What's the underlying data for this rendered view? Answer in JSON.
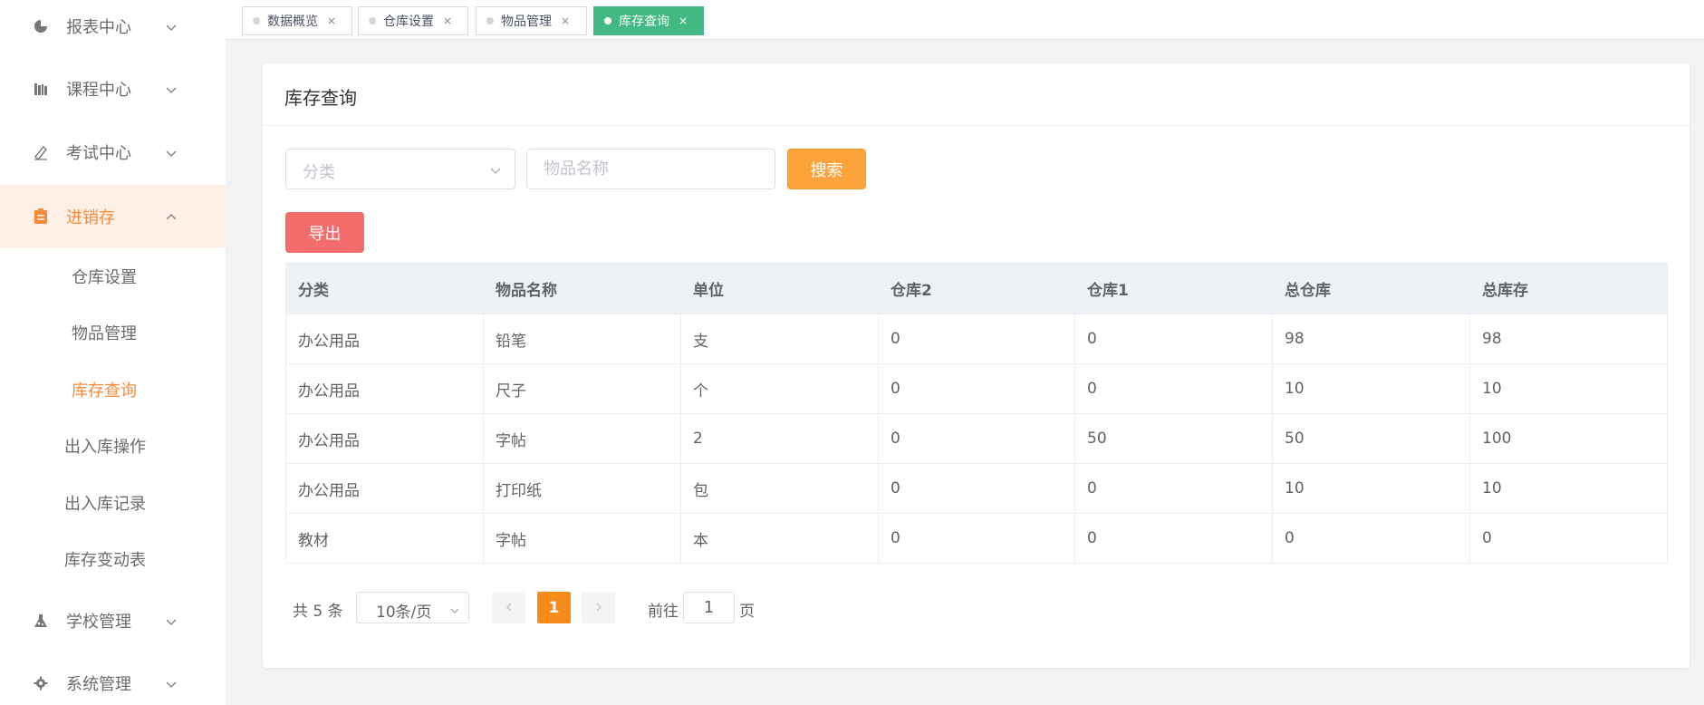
{
  "sidebar": {
    "menus": [
      {
        "label": "报表中心",
        "icon": "pie-chart-icon"
      },
      {
        "label": "课程中心",
        "icon": "books-icon"
      },
      {
        "label": "考试中心",
        "icon": "pen-icon"
      },
      {
        "label": "进销存",
        "icon": "clipboard-icon",
        "active": true
      },
      {
        "label": "学校管理",
        "icon": "flask-icon"
      },
      {
        "label": "系统管理",
        "icon": "gear-icon"
      }
    ],
    "sub_items": [
      {
        "label": "仓库设置"
      },
      {
        "label": "物品管理"
      },
      {
        "label": "库存查询",
        "active": true
      },
      {
        "label": "出入库操作"
      },
      {
        "label": "出入库记录"
      },
      {
        "label": "库存变动表"
      }
    ]
  },
  "tabs": [
    {
      "label": "数据概览",
      "close": "×"
    },
    {
      "label": "仓库设置",
      "close": "×"
    },
    {
      "label": "物品管理",
      "close": "×"
    },
    {
      "label": "库存查询",
      "close": "×",
      "active": true
    }
  ],
  "card": {
    "title": "库存查询",
    "category_placeholder": "分类",
    "name_placeholder": "物品名称",
    "search_label": "搜索",
    "export_label": "导出"
  },
  "table": {
    "headers": [
      "分类",
      "物品名称",
      "单位",
      "仓库2",
      "仓库1",
      "总仓库",
      "总库存"
    ],
    "rows": [
      [
        "办公用品",
        "铅笔",
        "支",
        "0",
        "0",
        "98",
        "98"
      ],
      [
        "办公用品",
        "尺子",
        "个",
        "0",
        "0",
        "10",
        "10"
      ],
      [
        "办公用品",
        "字帖",
        "2",
        "0",
        "50",
        "50",
        "100"
      ],
      [
        "办公用品",
        "打印纸",
        "包",
        "0",
        "0",
        "10",
        "10"
      ],
      [
        "教材",
        "字帖",
        "本",
        "0",
        "0",
        "0",
        "0"
      ]
    ]
  },
  "pagination": {
    "total": "共 5 条",
    "page_size": "10条/页",
    "current_page": "1",
    "goto_label": "前往",
    "goto_value": "1",
    "page_suffix": "页"
  },
  "colors": {
    "accent_orange": "#f98a37",
    "active_tab_green": "#42b983",
    "search_button": "#fca33b",
    "export_button": "#f56c6c",
    "pager_active": "#f98a1c"
  }
}
